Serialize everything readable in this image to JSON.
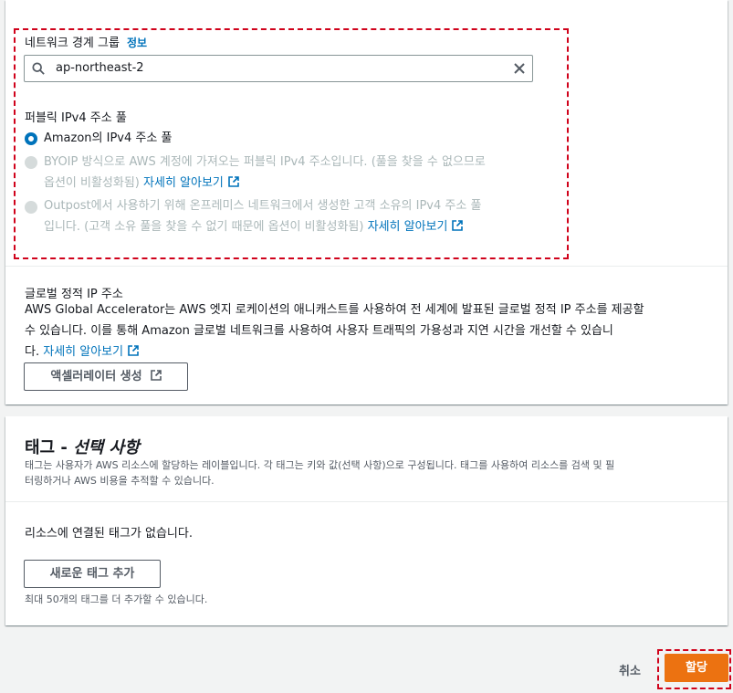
{
  "network": {
    "label": "네트워크 경계 그룹",
    "info": "정보",
    "search_value": "ap-northeast-2"
  },
  "ipv4_pool": {
    "label": "퍼블릭 IPv4 주소 풀",
    "options": [
      {
        "line1": "Amazon의 IPv4 주소 풀",
        "checked": true,
        "disabled": false
      },
      {
        "line1": "BYOIP 방식으로 AWS 계정에 가져오는 퍼블릭 IPv4 주소입니다. (풀을 찾을 수 없으므로",
        "line2": "옵션이 비활성화됨)",
        "link": "자세히 알아보기",
        "checked": false,
        "disabled": true
      },
      {
        "line1": "Outpost에서 사용하기 위해 온프레미스 네트워크에서 생성한 고객 소유의 IPv4 주소 풀",
        "line2": "입니다. (고객 소유 풀을 찾을 수 없기 때문에 옵션이 비활성화됨)",
        "link": "자세히 알아보기",
        "checked": false,
        "disabled": true
      }
    ]
  },
  "global_ip": {
    "title": "글로벌 정적 IP 주소",
    "desc1": "AWS Global Accelerator는 AWS 엣지 로케이션의 애니캐스트를 사용하여 전 세계에 발표된 글로벌 정적 IP 주소를 제공할",
    "desc2": "수 있습니다. 이를 통해 Amazon 글로벌 네트워크를 사용하여 사용자 트래픽의 가용성과 지연 시간을 개선할 수 있습니",
    "desc3_prefix": "다.",
    "link": "자세히 알아보기",
    "button": "액셀러레이터 생성"
  },
  "tags": {
    "title_main": "태그 - ",
    "title_optional": "선택 사항",
    "desc1": "태그는 사용자가 AWS 리소스에 할당하는 레이블입니다. 각 태그는 키와 값(선택 사항)으로 구성됩니다. 태그를 사용하여 리소스를 검색 및 필",
    "desc2": "터링하거나 AWS 비용을 추적할 수 있습니다.",
    "empty": "리소스에 연결된 태그가 없습니다.",
    "add_button": "새로운 태그 추가",
    "limit": "최대 50개의 태그를 더 추가할 수 있습니다."
  },
  "footer": {
    "cancel": "취소",
    "submit": "할당"
  }
}
